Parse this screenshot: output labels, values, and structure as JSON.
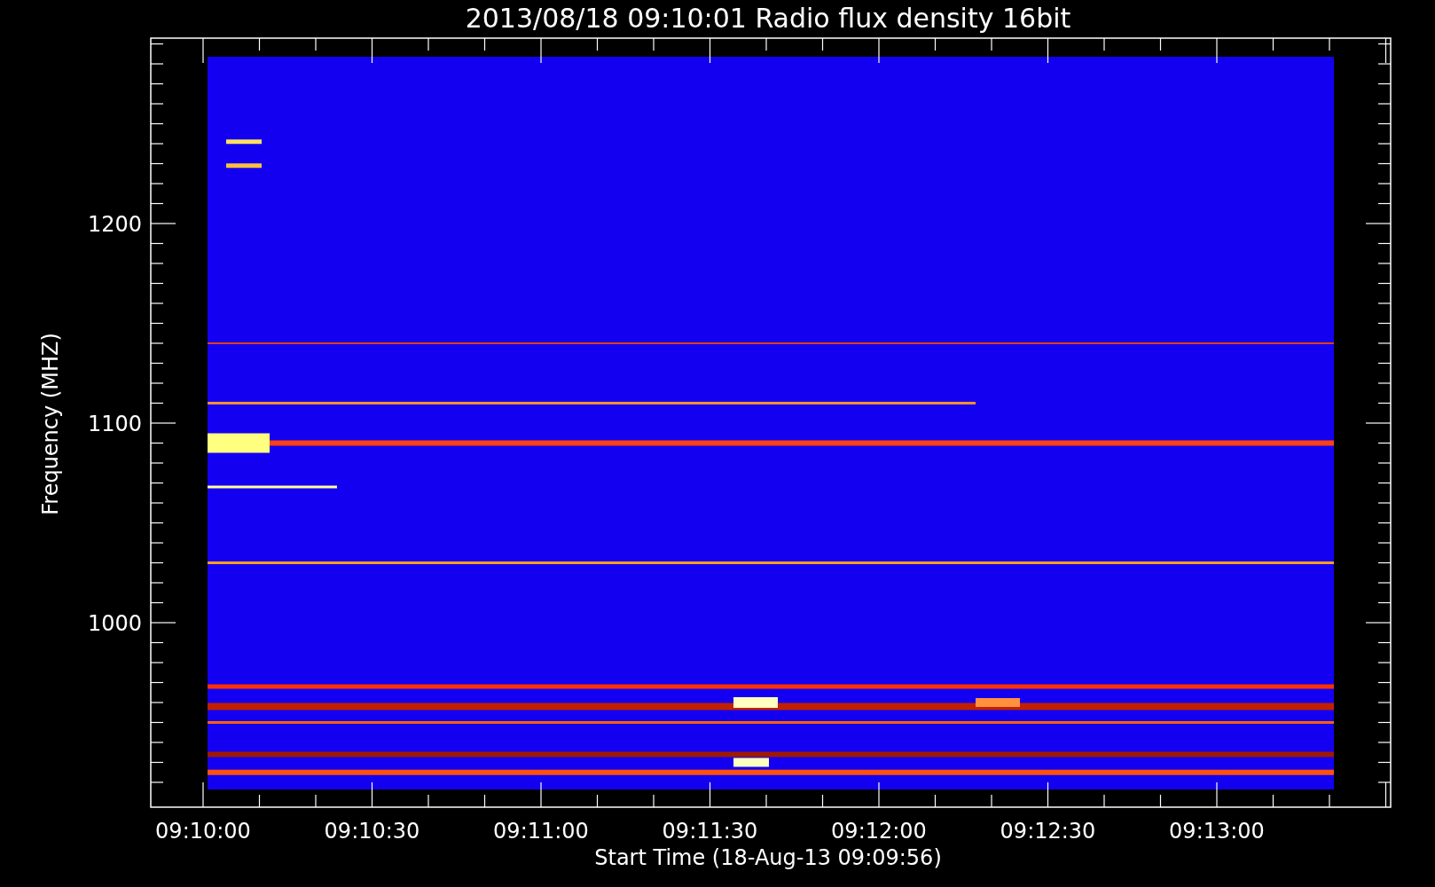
{
  "title": "2013/08/18 09:10:01 Radio flux density 16bit",
  "y_axis": {
    "label": "Frequency (MHZ)",
    "ticks": [
      "1200",
      "1100",
      "1000"
    ]
  },
  "x_axis": {
    "label": "Start Time (18-Aug-13 09:09:56)",
    "ticks": [
      "09:10:00",
      "09:10:30",
      "09:11:00",
      "09:11:30",
      "09:12:00",
      "09:12:30",
      "09:13:00"
    ]
  }
}
